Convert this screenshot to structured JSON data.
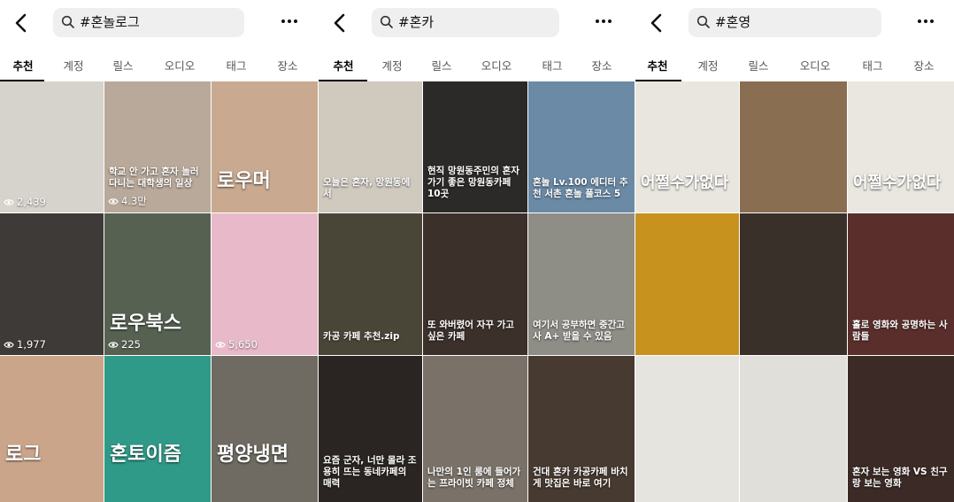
{
  "panels": [
    {
      "query": "#혼놀로그",
      "tabs": [
        "추천",
        "계정",
        "릴스",
        "오디오",
        "태그",
        "장소"
      ],
      "tiles": [
        {
          "views": "2,439",
          "overlay": "",
          "bg": "#d6d3cc"
        },
        {
          "views": "4.3만",
          "overlay": "학교 안 가고 혼자 놀러다니는 대학생의 일상",
          "bg": "#b8a99a"
        },
        {
          "views": "",
          "overlay": "로우머",
          "bg": "#c9a98f"
        },
        {
          "views": "1,977",
          "overlay": "",
          "bg": "#3e3a38"
        },
        {
          "views": "225",
          "overlay": "로우북스",
          "bg": "#566152"
        },
        {
          "views": "5,650",
          "overlay": "",
          "bg": "#e8b9c9"
        },
        {
          "views": "",
          "overlay": "로그",
          "bg": "#caa58a"
        },
        {
          "views": "",
          "overlay": "혼토이즘",
          "bg": "#2f9a88"
        },
        {
          "views": "",
          "overlay": "평양냉면",
          "bg": "#6f6b62"
        }
      ]
    },
    {
      "query": "#혼카",
      "tabs": [
        "추천",
        "계정",
        "릴스",
        "오디오",
        "태그",
        "장소"
      ],
      "tiles": [
        {
          "views": "",
          "overlay": "오늘은 혼자, 망원동에서",
          "bg": "#cfc9be"
        },
        {
          "views": "",
          "overlay": "현직 망원동주민의 혼자가기 좋은 망원동카페 10곳",
          "bg": "#2c2a28"
        },
        {
          "views": "",
          "overlay": "혼놀 Lv.100 에디터 추천 서촌 혼놀 풀코스 5",
          "bg": "#6a8aa6"
        },
        {
          "views": "",
          "overlay": "카공 카페 추천.zip",
          "bg": "#4a4637"
        },
        {
          "views": "",
          "overlay": "또 와버렸어 자꾸 가고 싶은 카페",
          "bg": "#3b302a"
        },
        {
          "views": "",
          "overlay": "여기서 공부하면 중간고사 A+ 받을 수 있음",
          "bg": "#8e8d86"
        },
        {
          "views": "",
          "overlay": "요즘 군자, 너만 몰라 조용히 뜨는 동네카페의 매력",
          "bg": "#2a2522"
        },
        {
          "views": "",
          "overlay": "나만의 1인 룸에 들어가는 프라이빗 카페 정체",
          "bg": "#7a7268"
        },
        {
          "views": "",
          "overlay": "건대 혼카 카공카페 바치게 맛집은 바로 여기",
          "bg": "#473a30"
        }
      ]
    },
    {
      "query": "#혼영",
      "tabs": [
        "추천",
        "계정",
        "릴스",
        "오디오",
        "태그",
        "장소"
      ],
      "tiles": [
        {
          "views": "",
          "overlay": "어쩔수가없다",
          "bg": "#e9e6df"
        },
        {
          "views": "",
          "overlay": "",
          "bg": "#8a6e52"
        },
        {
          "views": "",
          "overlay": "어쩔수가없다",
          "bg": "#eae7e0"
        },
        {
          "views": "",
          "overlay": "",
          "bg": "#c8921f"
        },
        {
          "views": "",
          "overlay": "",
          "bg": "#3a302a"
        },
        {
          "views": "",
          "overlay": "홀로 영화와 공명하는 사람들",
          "bg": "#5a2f2b"
        },
        {
          "views": "",
          "overlay": "",
          "bg": "#e6e4df"
        },
        {
          "views": "",
          "overlay": "",
          "bg": "#e1dfda"
        },
        {
          "views": "",
          "overlay": "혼자 보는 영화 VS 친구랑 보는 영화",
          "bg": "#3b2a26"
        }
      ]
    }
  ]
}
